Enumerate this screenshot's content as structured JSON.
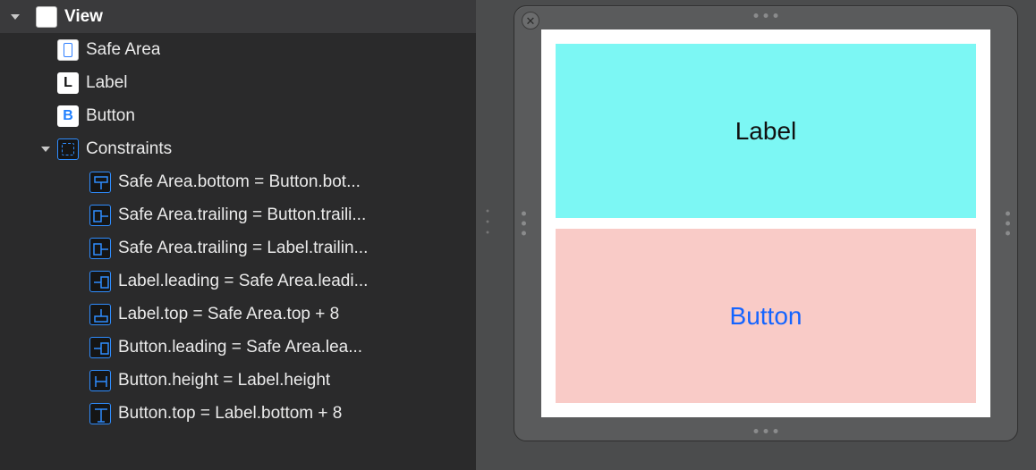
{
  "outline": {
    "root": {
      "label": "View"
    },
    "children": {
      "safeArea": "Safe Area",
      "label": "Label",
      "button": "Button",
      "constraintsHeader": "Constraints"
    },
    "iconLetters": {
      "label": "L",
      "button": "B"
    },
    "constraints": [
      "Safe Area.bottom = Button.bot...",
      "Safe Area.trailing = Button.traili...",
      "Safe Area.trailing = Label.trailin...",
      "Label.leading = Safe Area.leadi...",
      "Label.top = Safe Area.top + 8",
      "Button.leading = Safe Area.lea...",
      "Button.height = Label.height",
      "Button.top = Label.bottom + 8"
    ]
  },
  "preview": {
    "labelText": "Label",
    "buttonText": "Button",
    "closeGlyph": "✕"
  }
}
